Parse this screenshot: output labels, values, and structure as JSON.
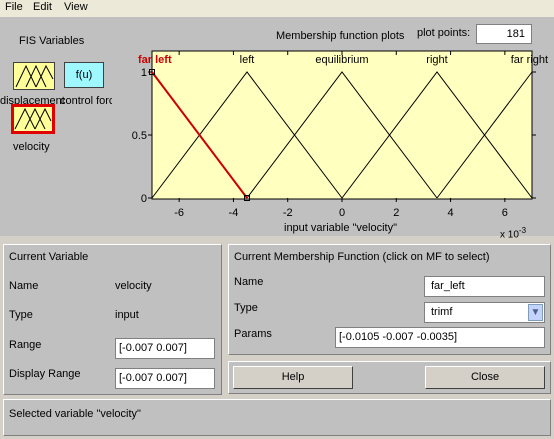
{
  "menu": [
    "File",
    "Edit",
    "View"
  ],
  "fis": {
    "title": "FIS Variables",
    "inputs": [
      {
        "label": "displacement"
      },
      {
        "label": "velocity"
      }
    ],
    "output": {
      "label": "control force",
      "func_text": "f(u)"
    }
  },
  "plot": {
    "title": "Membership function plots",
    "plot_points_label": "plot points:",
    "plot_points_value": "181",
    "xlabel": "input variable \"velocity\"",
    "exponent_label": "x 10-3"
  },
  "chart_data": {
    "type": "line",
    "title": "Membership function plots",
    "xlabel": "input variable \"velocity\"",
    "ylabel": "",
    "x_scale_note": "x 10^-3",
    "xlim": [
      -7,
      7
    ],
    "ylim": [
      0,
      1
    ],
    "xticks": [
      -6,
      -4,
      -2,
      0,
      2,
      4,
      6
    ],
    "yticks": [
      0,
      0.5,
      1
    ],
    "xtick_labels": [
      "-6",
      "-4",
      "-2",
      "0",
      "2",
      "4",
      "6"
    ],
    "ytick_labels": [
      "0",
      "0.5",
      "1"
    ],
    "selected": "far_left",
    "colors": {
      "normal": "#000000",
      "selected": "#cc0000",
      "plot_bg": "#ffffc0"
    },
    "series": [
      {
        "name": "far_left",
        "x": [
          -10.5,
          -7,
          -3.5
        ],
        "y": [
          0,
          1,
          0
        ]
      },
      {
        "name": "left",
        "x": [
          -7,
          -3.5,
          0
        ],
        "y": [
          0,
          1,
          0
        ]
      },
      {
        "name": "equilibrium",
        "x": [
          -3.5,
          0,
          3.5
        ],
        "y": [
          0,
          1,
          0
        ]
      },
      {
        "name": "right",
        "x": [
          0,
          3.5,
          7
        ],
        "y": [
          0,
          1,
          0
        ]
      },
      {
        "name": "far_right",
        "x": [
          3.5,
          7,
          10.5
        ],
        "y": [
          0,
          1,
          0
        ]
      }
    ],
    "series_labels": [
      "far_left",
      "left",
      "equilibrium",
      "right",
      "far_right"
    ],
    "series_label_texts": [
      "far left",
      "left",
      "equilibrium",
      "right",
      "far right"
    ]
  },
  "current_variable": {
    "header": "Current Variable",
    "name_label": "Name",
    "name_value": "velocity",
    "type_label": "Type",
    "type_value": "input",
    "range_label": "Range",
    "range_value": "[-0.007 0.007]",
    "display_range_label": "Display Range",
    "display_range_value": "[-0.007 0.007]"
  },
  "current_mf": {
    "header": "Current Membership Function (click on MF to select)",
    "name_label": "Name",
    "name_value": "far_left",
    "type_label": "Type",
    "type_value": "trimf",
    "params_label": "Params",
    "params_value": "[-0.0105 -0.007 -0.0035]"
  },
  "buttons": {
    "help": "Help",
    "close": "Close"
  },
  "status": "Selected variable \"velocity\""
}
